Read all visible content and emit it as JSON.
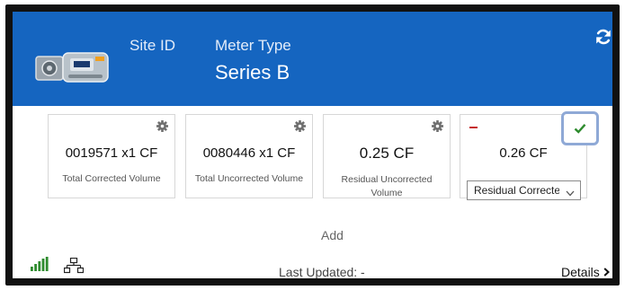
{
  "header": {
    "site_id_label": "Site ID",
    "meter_type_label": "Meter Type",
    "meter_type_value": "Series B",
    "background_color": "#1565c0"
  },
  "tiles": [
    {
      "value": "0019571 x1 CF",
      "label": "Total Corrected Volume"
    },
    {
      "value": "0080446 x1 CF",
      "label": "Total Uncorrected Volume"
    },
    {
      "value": "0.25 CF",
      "label": "Residual Uncorrected Volume"
    },
    {
      "value": "0.26 CF",
      "select_value": "Residual Corrected Volume"
    }
  ],
  "add_label": "Add",
  "footer": {
    "last_updated": "Last Updated: -",
    "details_label": "Details"
  },
  "icons": {
    "refresh": "refresh-icon",
    "gear": "gear-icon",
    "check": "check-icon",
    "minus": "minus-icon",
    "signal": "signal-bars-icon",
    "network": "network-icon",
    "chevron": "chevron-right-icon"
  },
  "colors": {
    "accent_blue": "#1565c0",
    "check_green": "#2e8b2e",
    "signal_green": "#2e8b2e",
    "remove_red": "#c62828"
  }
}
